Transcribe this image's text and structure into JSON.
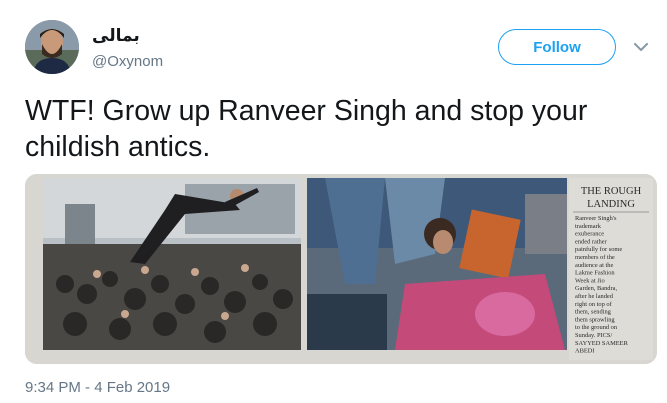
{
  "tweet": {
    "display_name": "بمالی",
    "handle": "@Oxynom",
    "follow_label": "Follow",
    "text": "WTF! Grow up Ranveer Singh and stop your childish antics.",
    "timestamp": "9:34 PM - 4 Feb 2019"
  },
  "clipping": {
    "headline_1": "THE ROUGH",
    "headline_2": "LANDING",
    "caption_lines": [
      "Ranveer Singh's",
      "trademark",
      "exuberance",
      "ended rather",
      "painfully for some",
      "members of the",
      "audience at the",
      "Lakme Fashion",
      "Week at Jio",
      "Garden, Bandra,",
      "after he landed",
      "right on top of",
      "them, sending",
      "them sprawling",
      "to the ground on",
      "Sunday. PICS/",
      "SAYYED SAMEER",
      "ABEDI"
    ]
  },
  "icons": {
    "caret": "chevron-down-icon"
  },
  "colors": {
    "accent": "#1da1f2",
    "secondary_text": "#657786"
  }
}
